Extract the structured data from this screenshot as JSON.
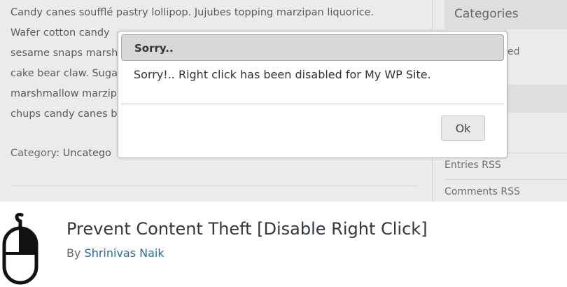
{
  "banner": {
    "post_lines": [
      "Candy canes soufflé pastry lollipop. Jujubes topping marzipan liquorice.",
      "Wafer cotton candy",
      "sesame snaps marsh",
      "cake bear claw. Suga",
      "marshmallow marzip",
      "chups candy canes b"
    ],
    "category_label": "Category:",
    "category_value": "Uncatego",
    "sidebar": {
      "title": "Categories",
      "partial_item": "ed",
      "items": [
        "Entries RSS",
        "Comments RSS"
      ]
    }
  },
  "dialog": {
    "title": "Sorry..",
    "message": "Sorry!.. Right click has been disabled for My WP Site.",
    "ok_label": "Ok"
  },
  "plugin": {
    "title": "Prevent Content Theft [Disable Right Click]",
    "by_label": "By",
    "author": "Shrinivas Naik",
    "icon": "mouse-icon"
  }
}
